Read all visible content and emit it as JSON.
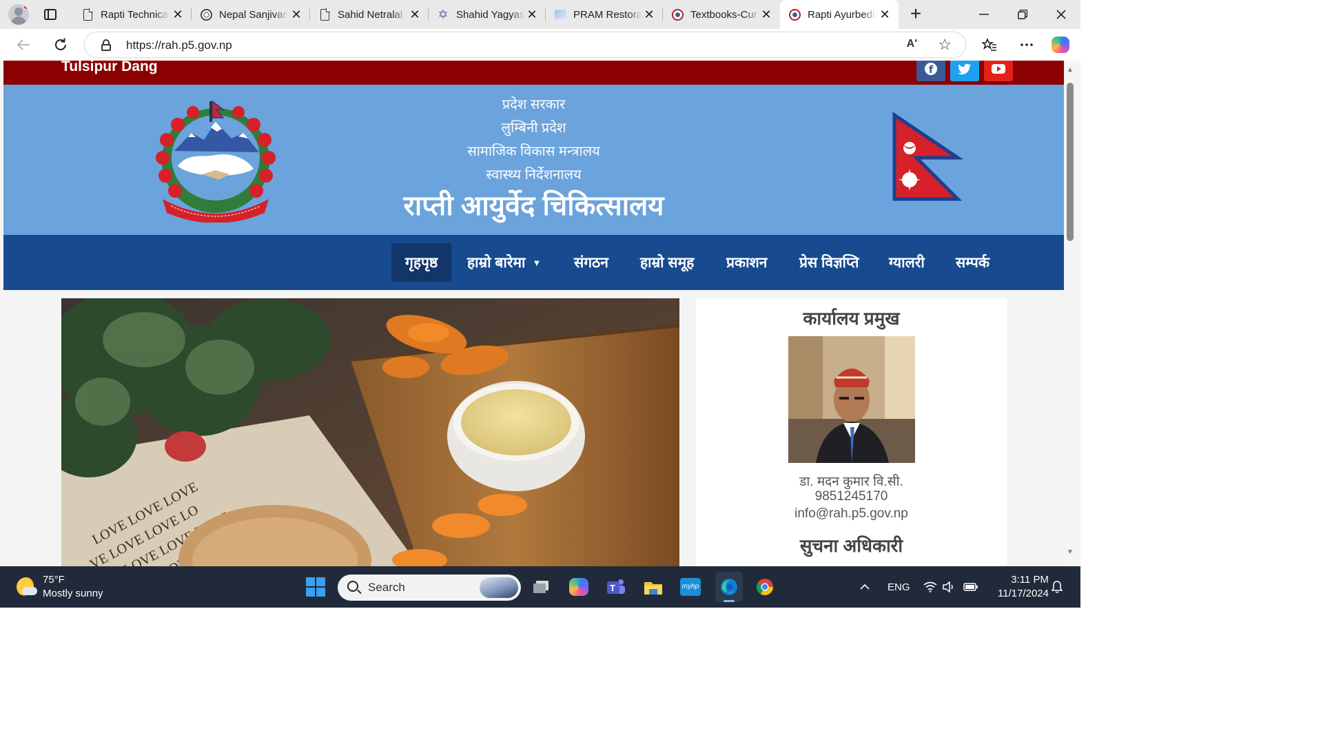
{
  "browser": {
    "tabs": [
      {
        "title": "Rapti Technical",
        "favicon": "document-icon"
      },
      {
        "title": "Nepal Sanjivan",
        "favicon": "seal-icon"
      },
      {
        "title": "Sahid Netralal",
        "favicon": "document-icon"
      },
      {
        "title": "Shahid Yagyas",
        "favicon": "star-icon"
      },
      {
        "title": "PRAM Restora",
        "favicon": "pram-icon"
      },
      {
        "title": "Textbooks-Cur",
        "favicon": "nepal-emblem-icon"
      },
      {
        "title": "Rapti Ayurbedi",
        "favicon": "nepal-emblem-icon",
        "active": true
      }
    ],
    "close_glyph": "✕",
    "new_tab_glyph": "+",
    "url": "https://rah.p5.gov.np",
    "read_aloud_glyph": "Aʹ",
    "favorite_glyph": "☆"
  },
  "site": {
    "location": "Tulsipur Dang",
    "social": {
      "facebook": "f",
      "twitter": "🐦",
      "youtube": ""
    },
    "header": {
      "line1": "प्रदेश सरकार",
      "line2": "लुम्बिनी प्रदेश",
      "line3": "सामाजिक विकास मन्त्रालय",
      "line4": "स्वास्थ्य निर्देशनालय",
      "title": "राप्ती आयुर्वेद चिकित्सालय"
    },
    "nav": [
      {
        "label": "गृहपृष्ठ",
        "active": true
      },
      {
        "label": "हाम्रो बारेमा",
        "dropdown": true
      },
      {
        "label": "संगठन"
      },
      {
        "label": "हाम्रो समूह"
      },
      {
        "label": "प्रकाशन"
      },
      {
        "label": "प्रेस विज्ञप्ति"
      },
      {
        "label": "ग्यालरी"
      },
      {
        "label": "सम्पर्क"
      }
    ],
    "sidebar": {
      "chief_title": "कार्यालय प्रमुख",
      "chief_name": "डा. मदन कुमार वि.सी.",
      "chief_phone": "9851245170",
      "chief_email": "info@rah.p5.gov.np",
      "info_officer_title": "सुचना अधिकारी"
    },
    "colors": {
      "top_strip": "#8b0000",
      "banner": "#6ba3dc",
      "nav": "#174a8f"
    }
  },
  "taskbar": {
    "temperature": "75°F",
    "weather": "Mostly sunny",
    "search_placeholder": "Search",
    "language": "ENG",
    "time": "3:11 PM",
    "date": "11/17/2024"
  }
}
